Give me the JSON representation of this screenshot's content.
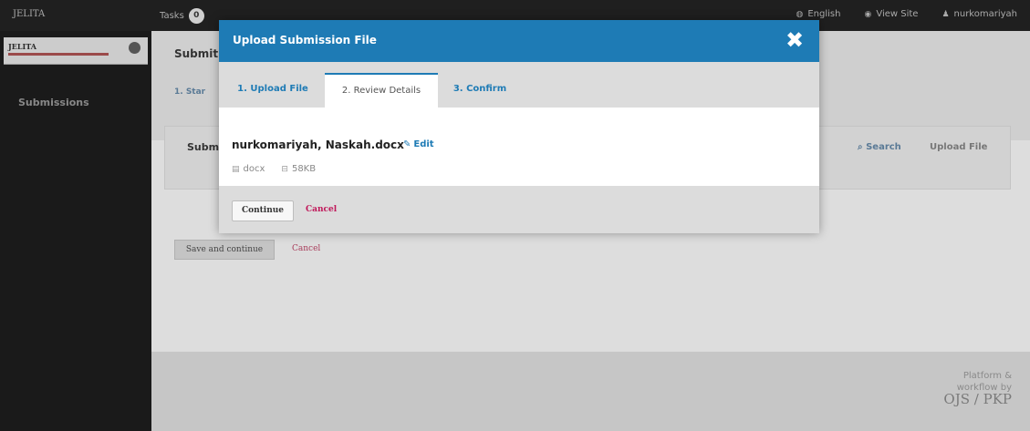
{
  "topbar": {
    "site_name": "JELITA",
    "tasks_label": "Tasks",
    "tasks_count": "0",
    "language": "English",
    "view_site": "View Site",
    "user": "nurkomariyah"
  },
  "sidebar": {
    "logo_text": "JELITA",
    "menu": [
      "Submissions"
    ]
  },
  "page": {
    "title": "Submit",
    "step_tab": "1. Star",
    "panel_title": "Subm",
    "search_label": "Search",
    "upload_label": "Upload File",
    "save_button": "Save and continue",
    "cancel": "Cancel"
  },
  "footer": {
    "line1": "Platform &",
    "line2": "workflow by",
    "brand": "OJS / PKP"
  },
  "modal": {
    "title": "Upload Submission File",
    "close_icon": "close-icon",
    "tabs": [
      "1. Upload File",
      "2. Review Details",
      "3. Confirm"
    ],
    "active_tab": 1,
    "file_name": "nurkomariyah, Naskah.docx",
    "edit_label": "Edit",
    "file_type": "docx",
    "file_size": "58KB",
    "continue_label": "Continue",
    "cancel_label": "Cancel"
  },
  "colors": {
    "header_blue": "#1e7bb5",
    "cancel_pink": "#c0185a",
    "dark_bar": "#1f1f1f"
  }
}
